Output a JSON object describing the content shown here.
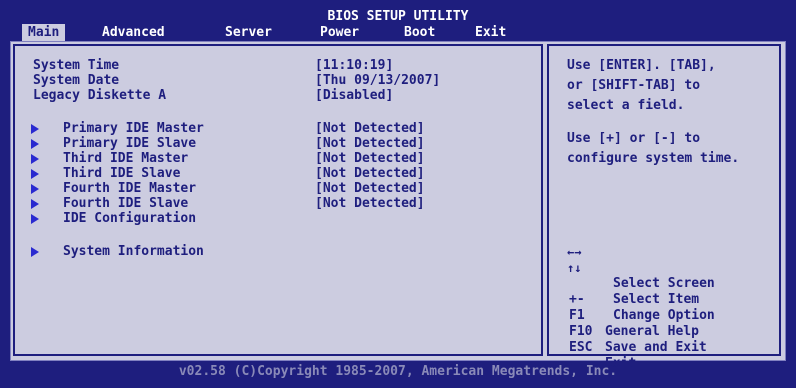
{
  "header": {
    "title": "BIOS SETUP UTILITY",
    "tabs": [
      {
        "label": "Main"
      },
      {
        "label": "Advanced"
      },
      {
        "label": "Server"
      },
      {
        "label": "Power"
      },
      {
        "label": "Boot"
      },
      {
        "label": "Exit"
      }
    ]
  },
  "main": {
    "settings": [
      {
        "label": "System Time",
        "value": "[11:10:19]"
      },
      {
        "label": "System Date",
        "value": "[Thu 09/13/2007]"
      },
      {
        "label": "Legacy Diskette A",
        "value": "[Disabled]"
      }
    ],
    "submenus": [
      {
        "label": "Primary IDE Master",
        "value": "[Not Detected]"
      },
      {
        "label": "Primary IDE Slave",
        "value": "[Not Detected]"
      },
      {
        "label": "Third IDE Master",
        "value": "[Not Detected]"
      },
      {
        "label": "Third IDE Slave",
        "value": "[Not Detected]"
      },
      {
        "label": "Fourth IDE Master",
        "value": "[Not Detected]"
      },
      {
        "label": "Fourth IDE Slave",
        "value": "[Not Detected]"
      },
      {
        "label": "IDE Configuration",
        "value": ""
      },
      {
        "label": "System Information",
        "value": ""
      }
    ]
  },
  "help": {
    "lines": [
      "Use [ENTER]. [TAB],",
      "or [SHIFT-TAB] to",
      "select a field.",
      "",
      "Use [+] or [-] to",
      "configure system time."
    ],
    "keys": [
      {
        "icon": "left-right-arrows-icon",
        "key": "←→",
        "desc": "Select Screen"
      },
      {
        "icon": "up-down-arrows-icon",
        "key": "↑↓",
        "desc": "Select Item"
      },
      {
        "icon": "",
        "key": "+-",
        "desc": "Change Option"
      },
      {
        "icon": "",
        "key": "F1",
        "desc": "General Help"
      },
      {
        "icon": "",
        "key": "F10",
        "desc": "Save and Exit"
      },
      {
        "icon": "",
        "key": "ESC",
        "desc": "Exit"
      }
    ]
  },
  "footer": {
    "copyright": "v02.58 (C)Copyright 1985-2007, American Megatrends, Inc."
  },
  "colors": {
    "background": "#1e1e7e",
    "panel": "#cccce0",
    "text_dark": "#1e1e7e",
    "arrow": "#2a2ad0",
    "footer_text": "#8a8ab8"
  }
}
